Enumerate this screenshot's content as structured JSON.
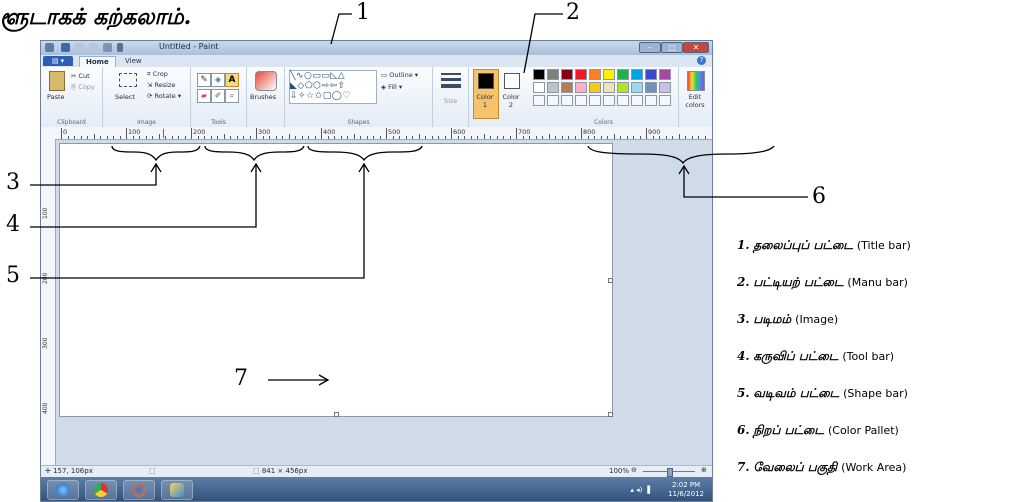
{
  "heading": "ளூடாகக் கற்கலாம்.",
  "paint": {
    "title": "Untitled - Paint",
    "file_tab": "▤ ▾",
    "tabs": [
      "Home",
      "View"
    ],
    "clipboard": {
      "paste": "Paste",
      "cut": "Cut",
      "copy": "Copy",
      "label": "Clipboard"
    },
    "image": {
      "select": "Select",
      "crop": "Crop",
      "resize": "Resize",
      "rotate": "Rotate ▾",
      "label": "Image"
    },
    "tools": {
      "label": "Tools",
      "text_tool": "A"
    },
    "brushes": "Brushes",
    "shapes": {
      "outline": "Outline ▾",
      "fill": "Fill ▾",
      "label": "Shapes"
    },
    "size": "Size",
    "color1": "Color 1",
    "color2": "Color 2",
    "colors_label": "Colors",
    "edit_colors": "Edit colors",
    "palette_row1": [
      "#000000",
      "#7f7f7f",
      "#880015",
      "#ed1c24",
      "#ff7f27",
      "#fff200",
      "#22b14c",
      "#00a2e8",
      "#3f48cc",
      "#a349a4"
    ],
    "palette_row2": [
      "#ffffff",
      "#c3c3c3",
      "#b97a57",
      "#ffaec9",
      "#ffc90e",
      "#efe4b0",
      "#b5e61d",
      "#99d9ea",
      "#7092be",
      "#c8bfe7"
    ],
    "ruler_ticks": [
      "0",
      "100",
      "200",
      "300",
      "400",
      "500",
      "600",
      "700",
      "800",
      "900"
    ],
    "vruler_ticks": [
      "100",
      "200",
      "300",
      "400",
      "500"
    ],
    "status_pos": "157, 106px",
    "status_size": "841 × 456px",
    "zoom": "100%",
    "clock_time": "2:02 PM",
    "clock_date": "11/6/2012"
  },
  "callouts": [
    "1",
    "2",
    "3",
    "4",
    "5",
    "6",
    "7"
  ],
  "legend": [
    {
      "num": "1.",
      "ta": "தலைப்புப் பட்டை",
      "en": "(Title bar)"
    },
    {
      "num": "2.",
      "ta": "பட்டியற் பட்டை",
      "en": "(Manu bar)"
    },
    {
      "num": "3.",
      "ta": "படிமம்",
      "en": "(Image)"
    },
    {
      "num": "4.",
      "ta": "கருவிப் பட்டை",
      "en": "(Tool bar)"
    },
    {
      "num": "5.",
      "ta": "வடிவம் பட்டை",
      "en": "(Shape bar)"
    },
    {
      "num": "6.",
      "ta": "நிறப் பட்டை",
      "en": "(Color Pallet)"
    },
    {
      "num": "7.",
      "ta": "வேலைப் பகுதி",
      "en": "(Work Area)"
    }
  ]
}
